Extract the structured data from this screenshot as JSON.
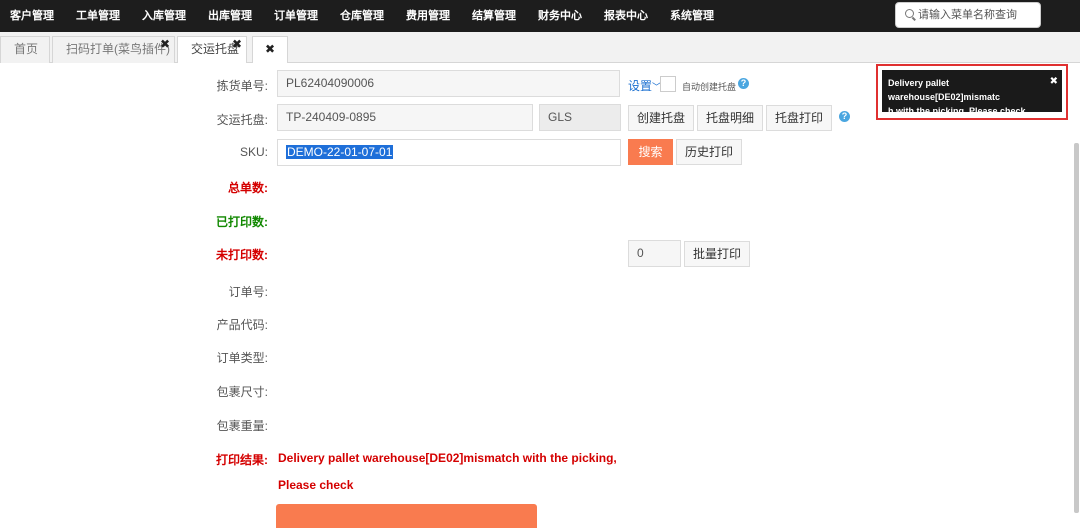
{
  "nav": {
    "items": [
      "客户管理",
      "工单管理",
      "入库管理",
      "出库管理",
      "订单管理",
      "仓库管理",
      "费用管理",
      "结算管理",
      "财务中心",
      "报表中心",
      "系统管理"
    ],
    "search_placeholder": "请输入菜单名称查询"
  },
  "tabs": [
    {
      "label": "首页"
    },
    {
      "label": "扫码打单(菜鸟插件)",
      "close": "✖"
    },
    {
      "label": "交运托盘",
      "close": "✖"
    },
    {
      "label": "",
      "close": "✖"
    }
  ],
  "form": {
    "pick_label": "拣货单号:",
    "pick_value": "PL62404090006",
    "settings_link": "设置",
    "auto_create_label": "自动创建托盘",
    "pallet_label": "交运托盘:",
    "pallet_value": "TP-240409-0895",
    "carrier_value": "GLS",
    "create_pallet_btn": "创建托盘",
    "pallet_detail_btn": "托盘明细",
    "pallet_print_btn": "托盘打印",
    "sku_label": "SKU:",
    "sku_value": "DEMO-22-01-07-01",
    "search_btn": "搜索",
    "history_print_btn": "历史打印",
    "total_label": "总单数:",
    "printed_label": "已打印数:",
    "unprinted_label": "未打印数:",
    "batch_qty_value": "0",
    "batch_print_btn": "批量打印",
    "order_no_label": "订单号:",
    "product_code_label": "产品代码:",
    "order_type_label": "订单类型:",
    "package_size_label": "包裹尺寸:",
    "package_weight_label": "包裹重量:",
    "print_result_label": "打印结果:",
    "print_result_line1": "Delivery pallet warehouse[DE02]mismatch with the picking,",
    "print_result_line2": "Please check"
  },
  "toast": {
    "line1": "Delivery pallet warehouse[DE02]mismatc",
    "line2": "h with the picking,  Please check",
    "close": "✖"
  },
  "help_icon": "?",
  "colors": {
    "accent": "#f97b4f",
    "error": "#d40000",
    "success": "#118800",
    "nav_bg": "#1d1d1d",
    "toast_outline": "#e03030"
  }
}
